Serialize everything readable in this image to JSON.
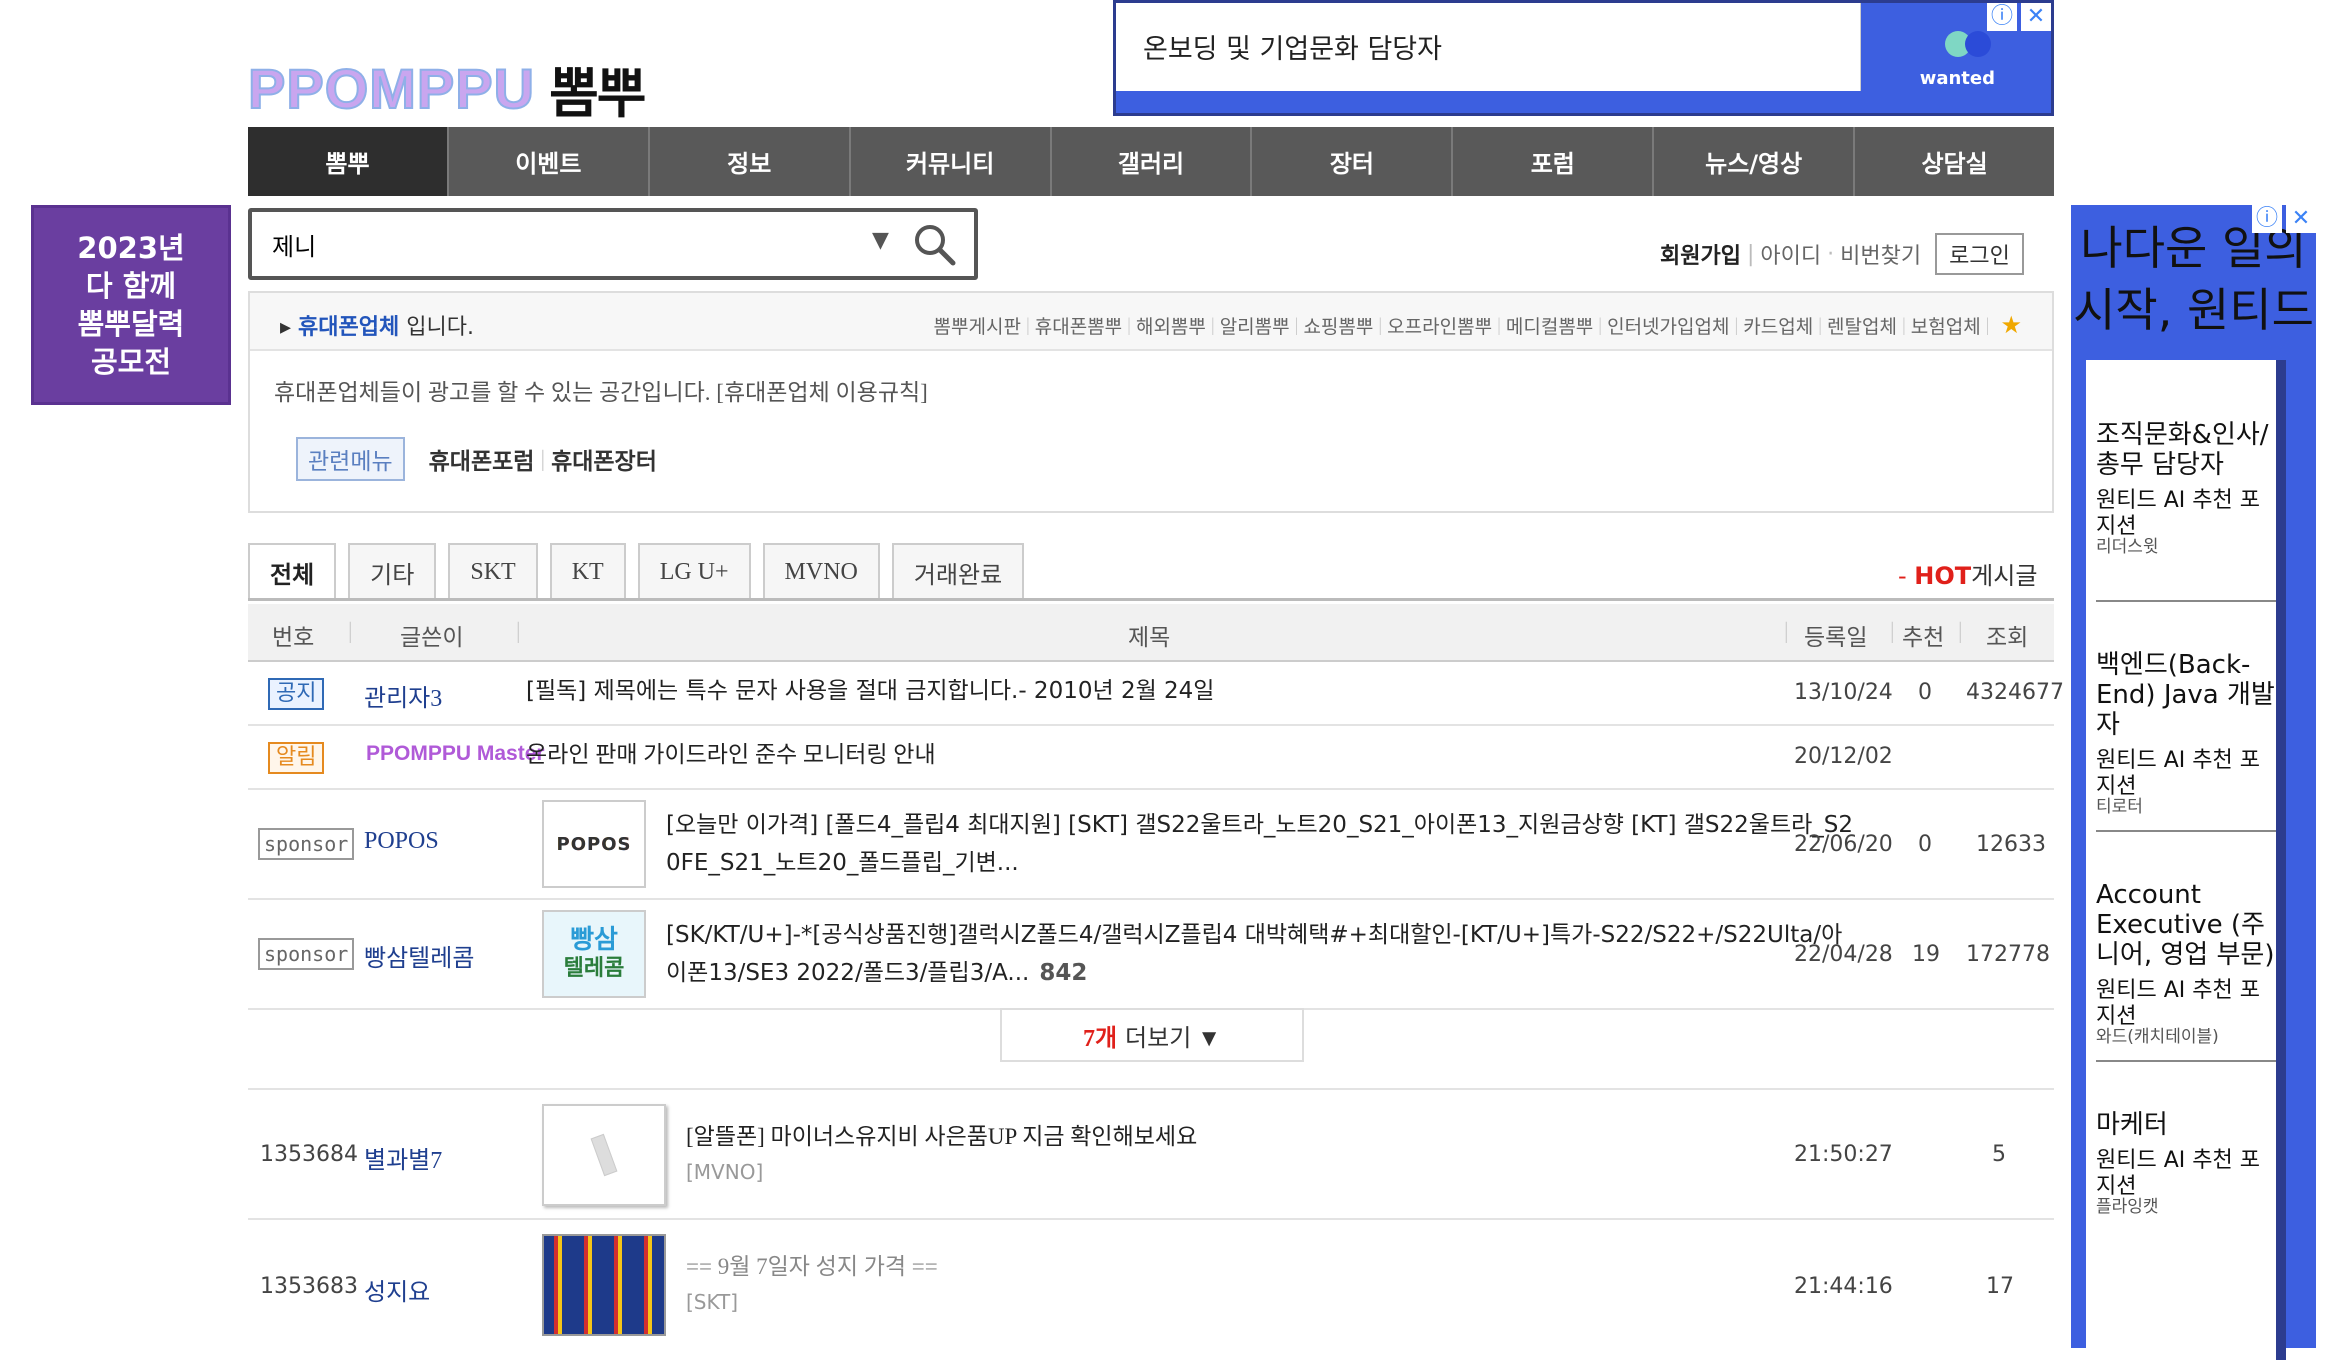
{
  "logo": {
    "en": "PPOMPPU",
    "ko": "뽐뿌"
  },
  "top_ad": {
    "text": "온보딩 및 기업문화 담당자",
    "brand": "wanted",
    "colors": {
      "bg": "#3d5fe0"
    }
  },
  "nav": [
    "뽐뿌",
    "이벤트",
    "정보",
    "커뮤니티",
    "갤러리",
    "장터",
    "포럼",
    "뉴스/영상",
    "상담실"
  ],
  "left_promo": {
    "line1": "2023년",
    "line2": "다 함께",
    "line3": "뽐뿌달력",
    "line4": "공모전"
  },
  "search": {
    "value": "제니"
  },
  "account": {
    "join": "회원가입",
    "id": "아이디",
    "pw": "비번찾기",
    "login": "로그인"
  },
  "board": {
    "category": "휴대폰업체",
    "suffix": " 입니다.",
    "links": [
      "뽐뿌게시판",
      "휴대폰뽐뿌",
      "해외뽐뿌",
      "알리뽐뿌",
      "쇼핑뽐뿌",
      "오프라인뽐뿌",
      "메디컬뽐뿌",
      "인터넷가입업체",
      "카드업체",
      "렌탈업체",
      "보험업체"
    ],
    "description": "휴대폰업체들이 광고를 할 수 있는 공간입니다. [휴대폰업체 이용규칙]",
    "related_label": "관련메뉴",
    "related": [
      "휴대폰포럼",
      "휴대폰장터"
    ]
  },
  "tabs": [
    "전체",
    "기타",
    "SKT",
    "KT",
    "LG U+",
    "MVNO",
    "거래완료"
  ],
  "hot": {
    "prefix": "- ",
    "hot": "HOT",
    "suffix": "게시글"
  },
  "table_header": {
    "no": "번호",
    "writer": "글쓴이",
    "title": "제목",
    "date": "등록일",
    "rec": "추천",
    "views": "조회"
  },
  "rows": {
    "notice": {
      "badge": "공지",
      "writer": "관리자3",
      "title": "[필독] 제목에는 특수 문자 사용을 절대 금지합니다.- 2010년 2월 24일",
      "date": "13/10/24",
      "rec": "0",
      "views": "4324677"
    },
    "alert": {
      "badge": "알림",
      "writer": "PPOMPPU Master",
      "title": "온라인 판매 가이드라인 준수 모니터링 안내",
      "date": "20/12/02"
    },
    "sp1": {
      "badge": "sponsor",
      "writer": "POPOS",
      "thumb": "POPOS",
      "title1": "[오늘만 이가격] [폴드4_플립4 최대지원] [SKT] 갤S22울트라_노트20_S21_아이폰13_지원금상향 [KT] 갤S22울트라_S2",
      "title2": "0FE_S21_노트20_폴드플립_기변...",
      "date": "22/06/20",
      "rec": "0",
      "views": "12633"
    },
    "sp2": {
      "badge": "sponsor",
      "writer": "빵삼텔레콤",
      "thumb1": "빵삼",
      "thumb2": "텔레콤",
      "title1": "[SK/KT/U+]-*[공식상품진행]갤럭시Z폴드4/갤럭시Z플립4 대박혜택#+최대할인-[KT/U+]특가-S22/S22+/S22Ulta/아",
      "title2": "이폰13/SE3 2022/폴드3/플립3/A...",
      "comments": "842",
      "date": "22/04/28",
      "rec": "19",
      "views": "172778"
    },
    "more": {
      "count": "7개",
      "label": "더보기 ▼"
    },
    "p1": {
      "no": "1353684",
      "writer": "별과별7",
      "title": "[알뜰폰] 마이너스유지비 사은품UP 지금 확인해보세요",
      "cat": "[MVNO]",
      "date": "21:50:27",
      "views": "5"
    },
    "p2": {
      "no": "1353683",
      "writer": "성지요",
      "title": "== 9월 7일자 성지 가격 ==",
      "cat": "[SKT]",
      "date": "21:44:16",
      "views": "17"
    }
  },
  "right_ad": {
    "headline": "나다운 일의 시작, 원티드",
    "items": [
      {
        "title": "조직문화&인사/총무 담당자",
        "sub": "원티드 AI 추천 포지션",
        "company": "리더스윗"
      },
      {
        "title": "백엔드(Back-End) Java 개발자",
        "sub": "원티드 AI 추천 포지션",
        "company": "티로터"
      },
      {
        "title": "Account Executive (주니어, 영업 부문)",
        "sub": "원티드 AI 추천 포지션",
        "company": "와드(캐치테이블)"
      },
      {
        "title": "마케터",
        "sub": "원티드 AI 추천 포지션",
        "company": "플라잉캣"
      }
    ]
  }
}
